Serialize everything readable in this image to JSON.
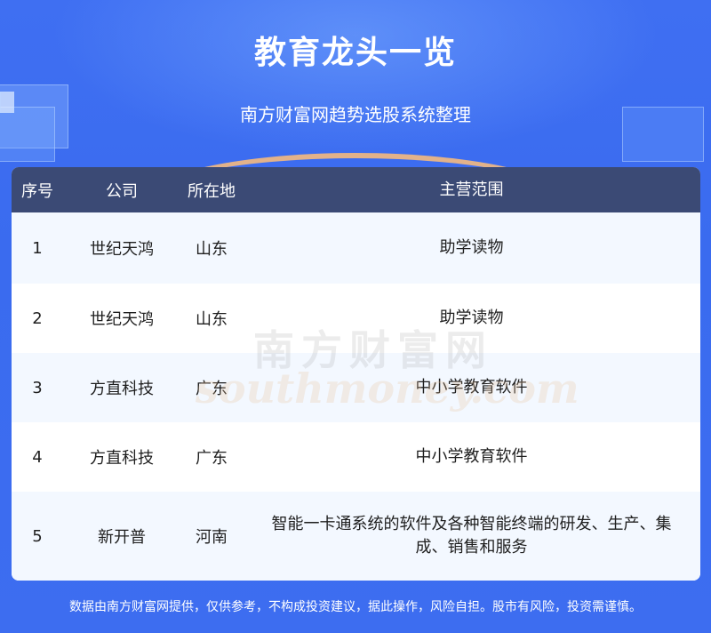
{
  "header": {
    "title": "教育龙头一览",
    "subtitle": "南方财富网趋势选股系统整理"
  },
  "table": {
    "columns": [
      "序号",
      "公司",
      "所在地",
      "主营范围"
    ],
    "rows": [
      {
        "no": "1",
        "company": "世纪天鸿",
        "location": "山东",
        "business": "助学读物"
      },
      {
        "no": "2",
        "company": "世纪天鸿",
        "location": "山东",
        "business": "助学读物"
      },
      {
        "no": "3",
        "company": "方直科技",
        "location": "广东",
        "business": "中小学教育软件"
      },
      {
        "no": "4",
        "company": "方直科技",
        "location": "广东",
        "business": "中小学教育软件"
      },
      {
        "no": "5",
        "company": "新开普",
        "location": "河南",
        "business": "智能一卡通系统的软件及各种智能终端的研发、生产、集成、销售和服务"
      }
    ]
  },
  "watermark": {
    "cn": "南方财富网",
    "en": "southmoney.com"
  },
  "footer": {
    "disclaimer": "数据由南方财富网提供，仅供参考，不构成投资建议，据此操作，风险自担。股市有风险，投资需谨慎。"
  },
  "colors": {
    "background": "#3f6ff2",
    "table_header": "#3b4a75",
    "row_alt": "#f3f8ff"
  }
}
